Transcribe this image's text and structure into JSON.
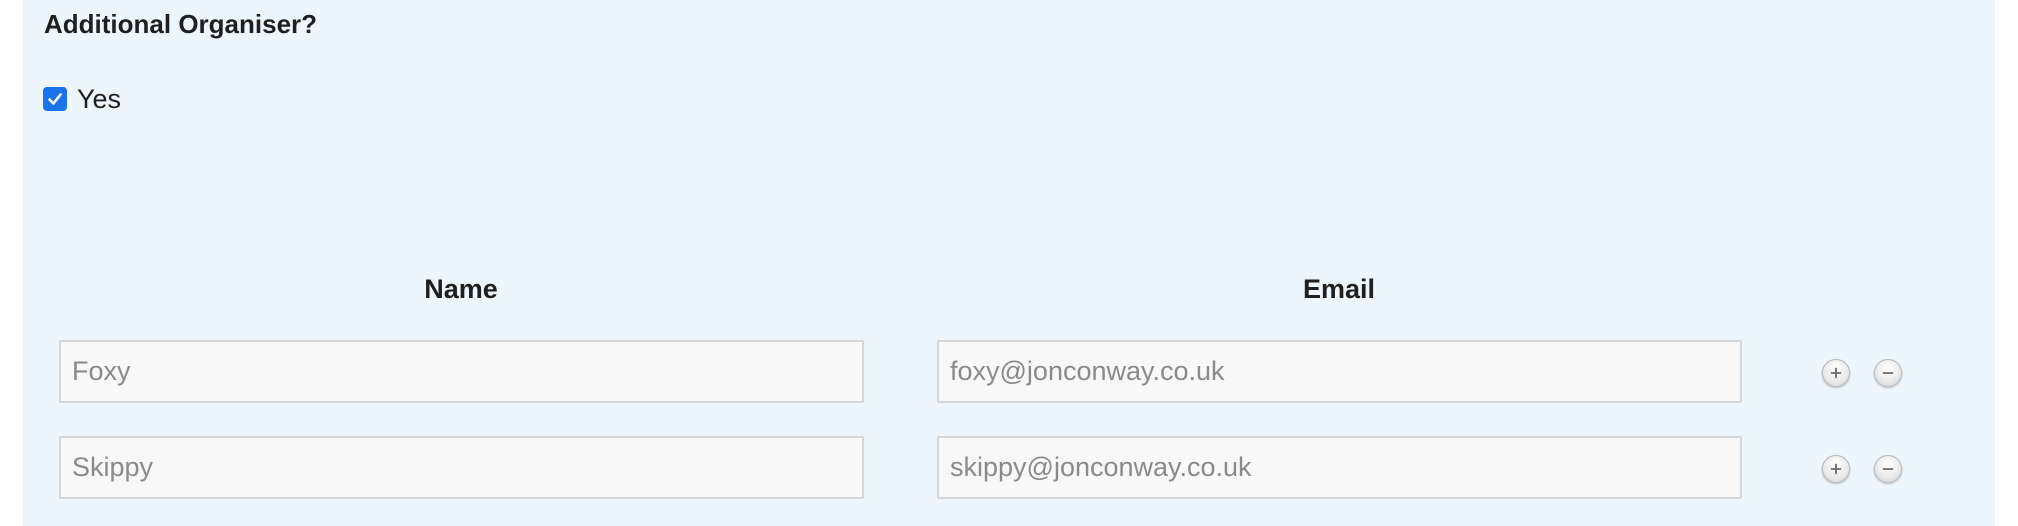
{
  "section": {
    "title": "Additional Organiser?"
  },
  "checkbox": {
    "label": "Yes",
    "checked": true,
    "color": "#1a73e8"
  },
  "columns": {
    "name_header": "Name",
    "email_header": "Email"
  },
  "rows": [
    {
      "name": "Foxy",
      "email": "foxy@jonconway.co.uk"
    },
    {
      "name": "Skippy",
      "email": "skippy@jonconway.co.uk"
    }
  ],
  "icons": {
    "add": "plus-circle-icon",
    "remove": "minus-circle-icon"
  },
  "colors": {
    "panel_background": "#eef6fd",
    "input_background": "#f8f8f8",
    "input_text": "#8a8a8a"
  }
}
